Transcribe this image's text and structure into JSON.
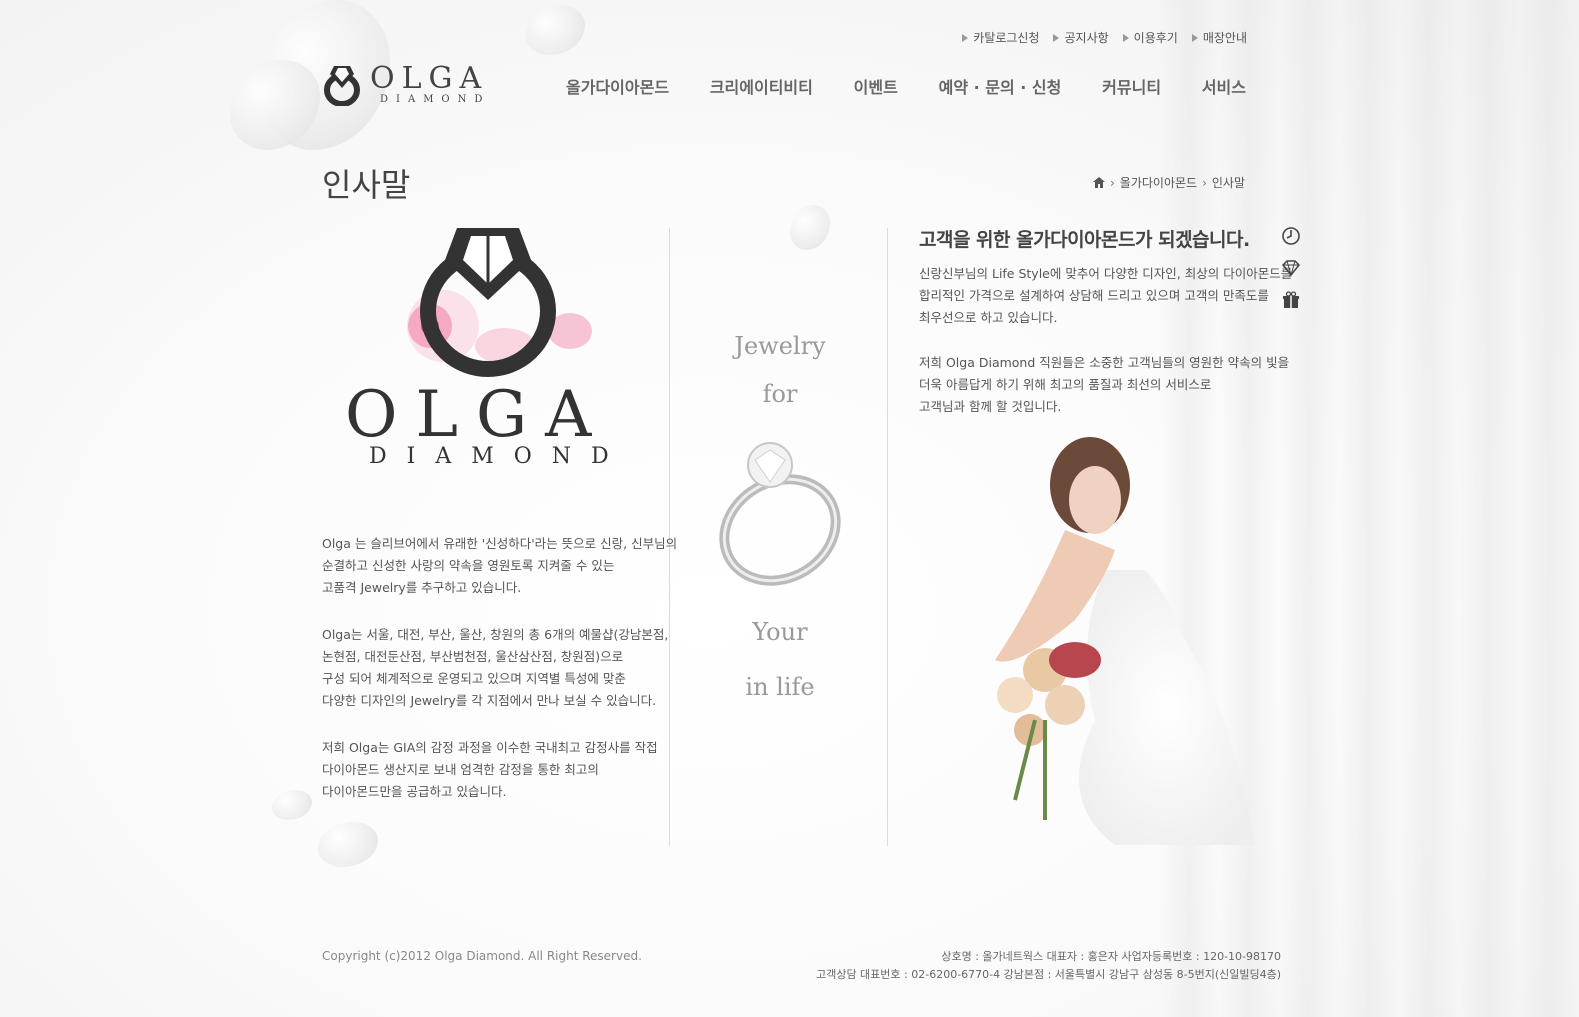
{
  "util_nav": [
    "카탈로그신청",
    "공지사항",
    "이용후기",
    "매장안내"
  ],
  "logo": {
    "name": "OLGA",
    "sub": "DIAMOND"
  },
  "gnb": [
    "올가다이아몬드",
    "크리에이티비티",
    "이벤트",
    "예약 · 문의 · 신청",
    "커뮤니티",
    "서비스"
  ],
  "page_title": "인사말",
  "breadcrumb": {
    "home_icon": "home-icon",
    "items": [
      "올가다이아몬드",
      "인사말"
    ]
  },
  "big_logo": {
    "name": "OLGA",
    "sub": "DIAMOND"
  },
  "left_paragraphs": [
    "Olga 는 슬리브어에서 유래한 '신성하다'라는 뜻으로 신랑, 신부님의\n순결하고 신성한 사랑의 약속을 영원토록 지켜줄 수 있는\n고품격 Jewelry를 추구하고 있습니다.",
    "Olga는 서울, 대전, 부산, 울산, 창원의 총 6개의 예물샵(강남본점,\n논현점, 대전둔산점, 부산범천점, 울산삼산점, 창원점)으로\n구성 되어 체계적으로 운영되고 있으며 지역별 특성에 맞춘\n다양한 디자인의 Jewelry를 각 지점에서 만나 보실 수 있습니다.",
    "저희 Olga는 GIA의 감정 과정을 이수한 국내최고 감정사를 작접\n다이아몬드 생산지로 보내 엄격한 감정을 통한 최고의\n다이아몬드만을 공급하고 있습니다."
  ],
  "tagline": [
    "Jewelry",
    "for",
    "Your",
    "in life"
  ],
  "right": {
    "title": "고객을 위한 올가다이아몬드가 되겠습니다.",
    "paragraphs": [
      "신랑신부님의 Life Style에 맞추어 다양한 디자인, 최상의 다이아몬드를\n합리적인 가격으로 설계하여 상담해 드리고 있으며 고객의 만족도를\n최우선으로 하고 있습니다.",
      "저희 Olga Diamond 직원들은 소중한 고객님들의 영원한 약속의 빛을\n더욱 아름답게 하기 위해 최고의 품질과 최선의 서비스로\n고객님과 함께 할 것입니다."
    ]
  },
  "side_icons": [
    "clock-icon",
    "diamond-icon",
    "gift-icon"
  ],
  "footer": {
    "copyright": "Copyright (c)2012 Olga Diamond. All Right Reserved.",
    "line1": "상호명 : 올가네트웍스    대표자 : 홍은자    사업자등록번호 : 120-10-98170",
    "line2": "고객상담 대표번호 : 02-6200-6770-4    강남본점 : 서울특별시 강남구 삼성동 8-5번지(신일빌딩4층)"
  },
  "colors": {
    "text": "#555555",
    "title": "#444444",
    "accent_pink": "#e0457b",
    "line": "#dcdcdc"
  }
}
